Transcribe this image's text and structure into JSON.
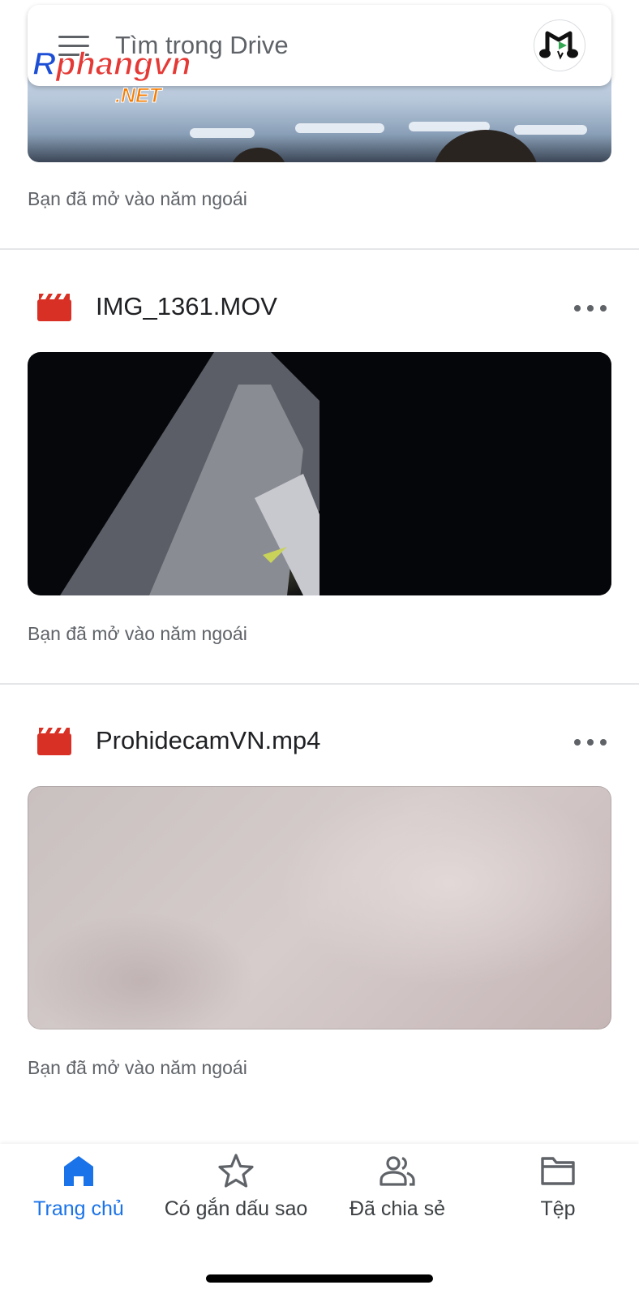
{
  "search": {
    "placeholder": "Tìm trong Drive"
  },
  "watermark": {
    "brand": "Rphangvn",
    "suffix": ".NET"
  },
  "icons": {
    "menu": "menu-icon",
    "avatar": "music-note-avatar",
    "file_type": "video-file-icon",
    "more": "more-horizontal-icon",
    "home": "home-icon",
    "starred": "star-icon",
    "shared": "people-icon",
    "files": "folder-icon"
  },
  "colors": {
    "accent": "#1a73e8",
    "video_icon": "#d93025",
    "secondary_text": "#5f6368"
  },
  "files": [
    {
      "name": "",
      "activity": "Bạn đã mở vào năm ngoái"
    },
    {
      "name": "IMG_1361.MOV",
      "activity": "Bạn đã mở vào năm ngoái"
    },
    {
      "name": "ProhidecamVN.mp4",
      "activity": "Bạn đã mở vào năm ngoái"
    }
  ],
  "nav": {
    "items": [
      {
        "label": "Trang chủ",
        "active": true
      },
      {
        "label": "Có gắn dấu sao",
        "active": false
      },
      {
        "label": "Đã chia sẻ",
        "active": false
      },
      {
        "label": "Tệp",
        "active": false
      }
    ]
  }
}
